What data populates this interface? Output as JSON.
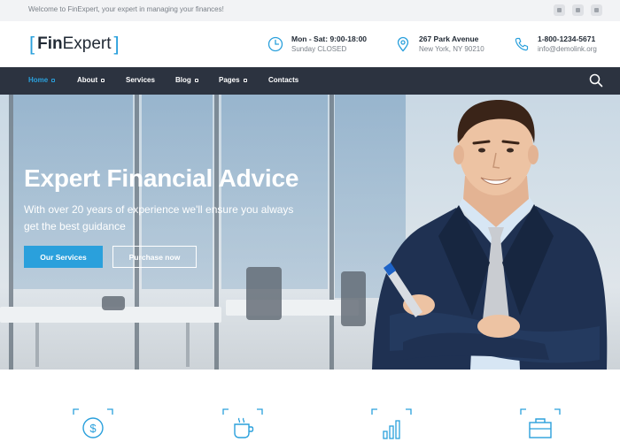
{
  "topbar": {
    "welcome": "Welcome to FinExpert, your expert in managing your finances!",
    "social_icons": [
      "facebook-icon",
      "twitter-icon",
      "google-plus-icon"
    ]
  },
  "header": {
    "logo": {
      "bold": "Fin",
      "light": "Expert"
    },
    "hours": {
      "title": "Mon - Sat: 9:00-18:00",
      "subtitle": "Sunday CLOSED",
      "icon": "clock-icon"
    },
    "address": {
      "title": "267 Park Avenue",
      "subtitle": "New York, NY 90210",
      "icon": "map-pin-icon"
    },
    "contact": {
      "title": "1-800-1234-5671",
      "subtitle": "info@demolink.org",
      "icon": "phone-icon"
    }
  },
  "nav": {
    "items": [
      {
        "label": "Home",
        "dropdown": true,
        "active": true
      },
      {
        "label": "About",
        "dropdown": true,
        "active": false
      },
      {
        "label": "Services",
        "dropdown": false,
        "active": false
      },
      {
        "label": "Blog",
        "dropdown": true,
        "active": false
      },
      {
        "label": "Pages",
        "dropdown": true,
        "active": false
      },
      {
        "label": "Contacts",
        "dropdown": false,
        "active": false
      }
    ],
    "search_icon": "search-icon"
  },
  "hero": {
    "title": "Expert Financial Advice",
    "subtitle": "With over 20 years of experience we'll ensure you always get the best guidance",
    "primary_button": "Our Services",
    "secondary_button": "Purchase now"
  },
  "features": {
    "icons": [
      "dollar-coin-icon",
      "coffee-cup-icon",
      "bar-chart-icon",
      "briefcase-icon"
    ]
  },
  "colors": {
    "accent": "#2aa0dc",
    "nav_background": "#2c3340",
    "topbar_background": "#f2f3f5",
    "dark_text": "#222b36"
  }
}
